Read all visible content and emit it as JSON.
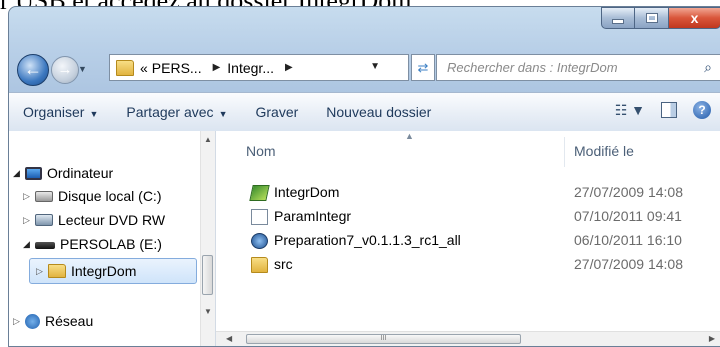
{
  "caption": {
    "text": "r USB et accédez au dossier IntegrDom."
  },
  "window": {
    "controls": {
      "minimize_icon": "minimize-icon",
      "maximize_icon": "maximize-icon",
      "close_label": "x"
    }
  },
  "address": {
    "prefix": "«",
    "segments": [
      "PERS...",
      "Integr..."
    ]
  },
  "search": {
    "placeholder": "Rechercher dans : IntegrDom"
  },
  "toolbar": {
    "organize": "Organiser",
    "share": "Partager avec",
    "burn": "Graver",
    "new_folder": "Nouveau dossier"
  },
  "nav": {
    "items": [
      {
        "label": "Ordinateur",
        "icon": "computer-icon"
      },
      {
        "label": "Disque local (C:)",
        "icon": "hard-disk-icon"
      },
      {
        "label": "Lecteur DVD RW",
        "icon": "dvd-drive-icon"
      },
      {
        "label": "PERSOLAB (E:)",
        "icon": "usb-drive-icon"
      },
      {
        "label": "IntegrDom",
        "icon": "folder-icon",
        "selected": true
      },
      {
        "label": "Réseau",
        "icon": "network-icon"
      }
    ]
  },
  "list": {
    "columns": {
      "name": "Nom",
      "modified": "Modifié le"
    },
    "rows": [
      {
        "name": "IntegrDom",
        "modified": "27/07/2009 14:08",
        "icon": "application-icon"
      },
      {
        "name": "ParamIntegr",
        "modified": "07/10/2011 09:41",
        "icon": "document-icon"
      },
      {
        "name": "Preparation7_v0.1.1.3_rc1_all",
        "modified": "06/10/2011 16:10",
        "icon": "setup-icon"
      },
      {
        "name": "src",
        "modified": "27/07/2009 14:08",
        "icon": "folder-icon"
      }
    ]
  },
  "scrollbar": {
    "grip": "III"
  }
}
